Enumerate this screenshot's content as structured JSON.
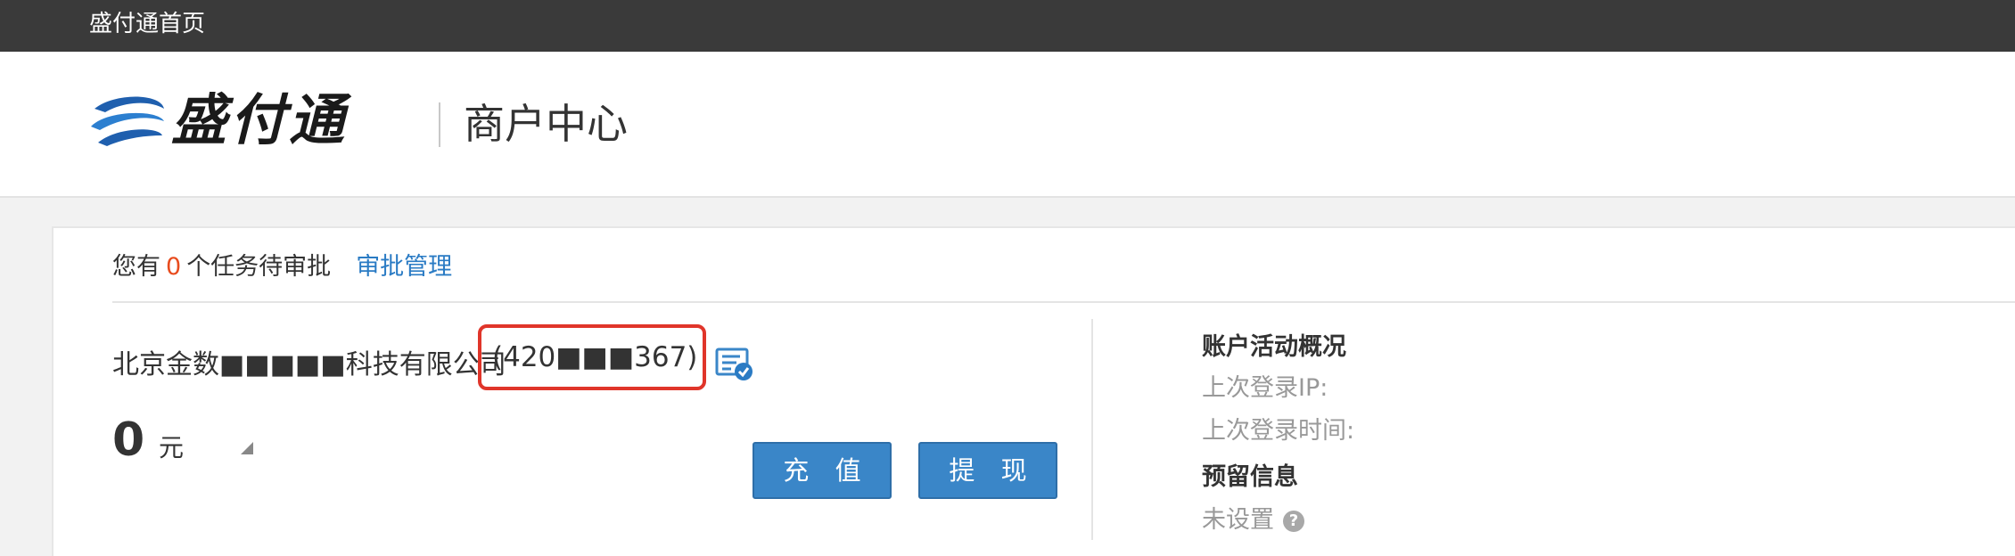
{
  "topbar": {
    "home_label": "盛付通首页"
  },
  "header": {
    "logo_text": "盛付通",
    "title": "商户中心"
  },
  "tasks": {
    "prefix": "您有",
    "count": "0",
    "suffix": "个任务待审批",
    "link": "审批管理"
  },
  "account": {
    "company_name": "北京金数■■■■■科技有限公司",
    "merchant_id": "(420■■■367)",
    "balance": "0",
    "unit": "元"
  },
  "buttons": {
    "recharge": "充 值",
    "withdraw": "提 现"
  },
  "activity": {
    "title": "账户活动概况",
    "last_login_ip": "上次登录IP:",
    "last_login_time": "上次登录时间:"
  },
  "reserved": {
    "title": "预留信息",
    "value": "未设置"
  },
  "colors": {
    "topbar": "#3a3a3a",
    "accent_blue": "#3a86c8",
    "link_blue": "#2a7bc4",
    "highlight_red": "#e0352a",
    "count_orange": "#e84c1e"
  },
  "icons": [
    "logo-swirl-icon",
    "certificate-icon",
    "triangle-toggle-icon",
    "help-icon"
  ]
}
